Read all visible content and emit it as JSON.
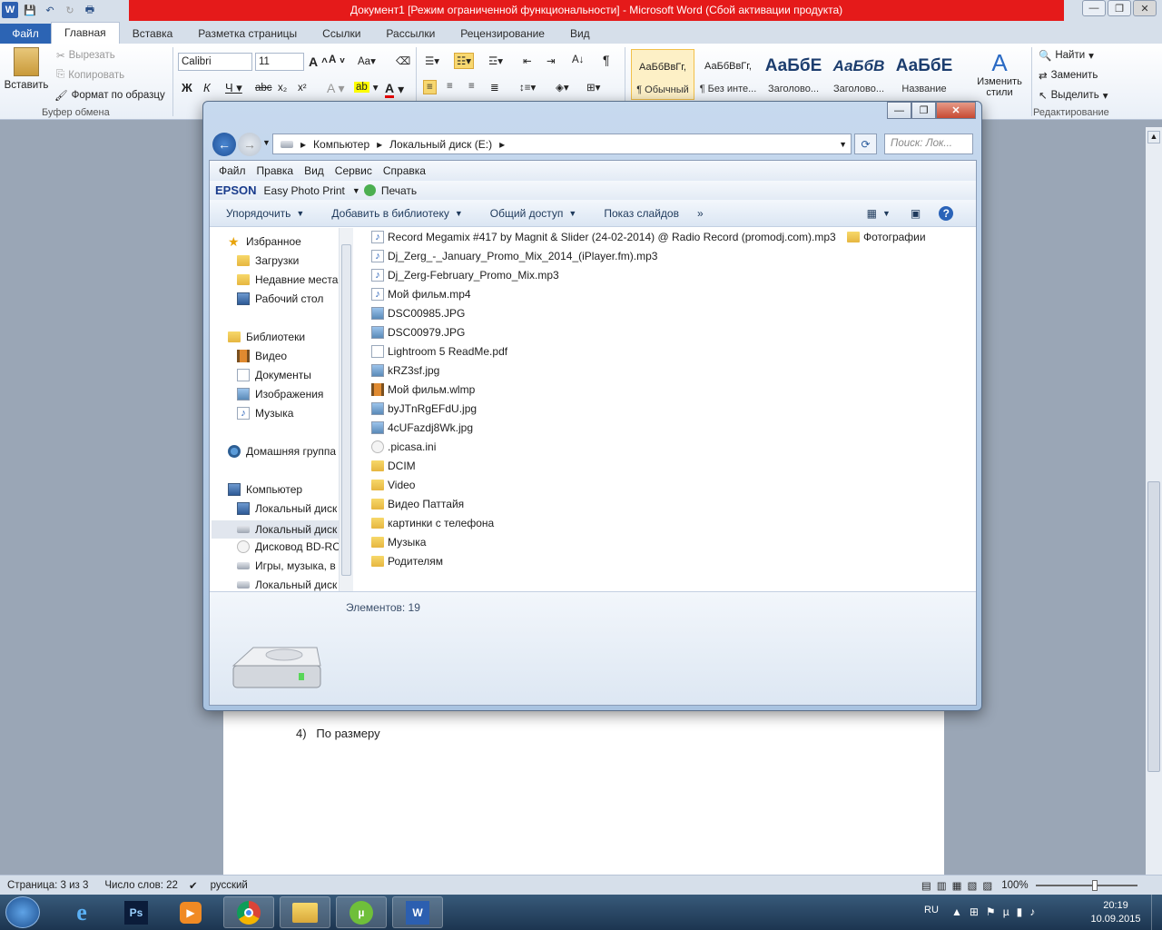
{
  "word": {
    "title": "Документ1 [Режим ограниченной функциональности]  -  Microsoft Word (Сбой активации продукта)",
    "tabs": [
      "Файл",
      "Главная",
      "Вставка",
      "Разметка страницы",
      "Ссылки",
      "Рассылки",
      "Рецензирование",
      "Вид"
    ],
    "clipboard": {
      "paste": "Вставить",
      "cut": "Вырезать",
      "copy": "Копировать",
      "format": "Формат по образцу",
      "group": "Буфер обмена"
    },
    "font": {
      "name": "Calibri",
      "size": "11"
    },
    "styles": [
      {
        "preview": "АаБбВвГг,",
        "name": "¶ Обычный"
      },
      {
        "preview": "АаБбВвГг,",
        "name": "¶ Без инте..."
      },
      {
        "preview": "АаБбЕ",
        "name": "Заголово..."
      },
      {
        "preview": "АаБбВ",
        "name": "Заголово..."
      },
      {
        "preview": "АаБбЕ",
        "name": "Название"
      }
    ],
    "change_styles": "Изменить стили",
    "editing": {
      "find": "Найти",
      "replace": "Заменить",
      "select": "Выделить",
      "group": "Редактирование"
    },
    "doc_text": "4)   По размеру",
    "status": {
      "page": "Страница: 3 из 3",
      "words": "Число слов: 22",
      "lang": "русский",
      "zoom": "100%"
    }
  },
  "explorer": {
    "breadcrumb": [
      "Компьютер",
      "Локальный диск (E:)"
    ],
    "search_placeholder": "Поиск: Лок...",
    "menu": [
      "Файл",
      "Правка",
      "Вид",
      "Сервис",
      "Справка"
    ],
    "epson": {
      "brand": "EPSON",
      "app": "Easy Photo Print",
      "print": "Печать"
    },
    "commands": [
      "Упорядочить",
      "Добавить в библиотеку",
      "Общий доступ",
      "Показ слайдов"
    ],
    "nav": [
      {
        "label": "Избранное",
        "icon": "star"
      },
      {
        "label": "Загрузки",
        "icon": "folder"
      },
      {
        "label": "Недавние места",
        "icon": "folder"
      },
      {
        "label": "Рабочий стол",
        "icon": "comp"
      },
      {
        "label": "Библиотеки",
        "icon": "folder"
      },
      {
        "label": "Видео",
        "icon": "video"
      },
      {
        "label": "Документы",
        "icon": "doc"
      },
      {
        "label": "Изображения",
        "icon": "img"
      },
      {
        "label": "Музыка",
        "icon": "audio"
      },
      {
        "label": "Домашняя группа",
        "icon": "net"
      },
      {
        "label": "Компьютер",
        "icon": "comp"
      },
      {
        "label": "Локальный диск",
        "icon": "comp"
      },
      {
        "label": "Локальный диск",
        "icon": "drive"
      },
      {
        "label": "Дисковод BD-RC",
        "icon": "ini"
      },
      {
        "label": "Игры, музыка, в",
        "icon": "drive"
      },
      {
        "label": "Локальный диск",
        "icon": "drive"
      }
    ],
    "files": [
      {
        "name": "Record Megamix #417 by Magnit & Slider (24-02-2014) @ Radio Record (promodj.com).mp3",
        "icon": "audio"
      },
      {
        "name": "Dj_Zerg_-_January_Promo_Mix_2014_(iPlayer.fm).mp3",
        "icon": "audio"
      },
      {
        "name": "Dj_Zerg-February_Promo_Mix.mp3",
        "icon": "audio"
      },
      {
        "name": "Мой фильм.mp4",
        "icon": "audio"
      },
      {
        "name": "DSC00985.JPG",
        "icon": "img"
      },
      {
        "name": "DSC00979.JPG",
        "icon": "img"
      },
      {
        "name": "Lightroom 5 ReadMe.pdf",
        "icon": "doc"
      },
      {
        "name": "kRZ3sf.jpg",
        "icon": "img"
      },
      {
        "name": "Мой фильм.wlmp",
        "icon": "video"
      },
      {
        "name": "byJTnRgEFdU.jpg",
        "icon": "img"
      },
      {
        "name": "4cUFazdj8Wk.jpg",
        "icon": "img"
      },
      {
        "name": ".picasa.ini",
        "icon": "ini"
      },
      {
        "name": "DCIM",
        "icon": "folder"
      },
      {
        "name": "Video",
        "icon": "folder"
      },
      {
        "name": "Видео Паттайя",
        "icon": "folder"
      },
      {
        "name": "картинки с  телефона",
        "icon": "folder"
      },
      {
        "name": "Музыка",
        "icon": "folder"
      },
      {
        "name": "Родителям",
        "icon": "folder"
      }
    ],
    "files_col2": [
      {
        "name": "Фотографии",
        "icon": "folder"
      }
    ],
    "item_count": "Элементов: 19"
  },
  "taskbar": {
    "lang": "RU",
    "time": "20:19",
    "date": "10.09.2015"
  }
}
